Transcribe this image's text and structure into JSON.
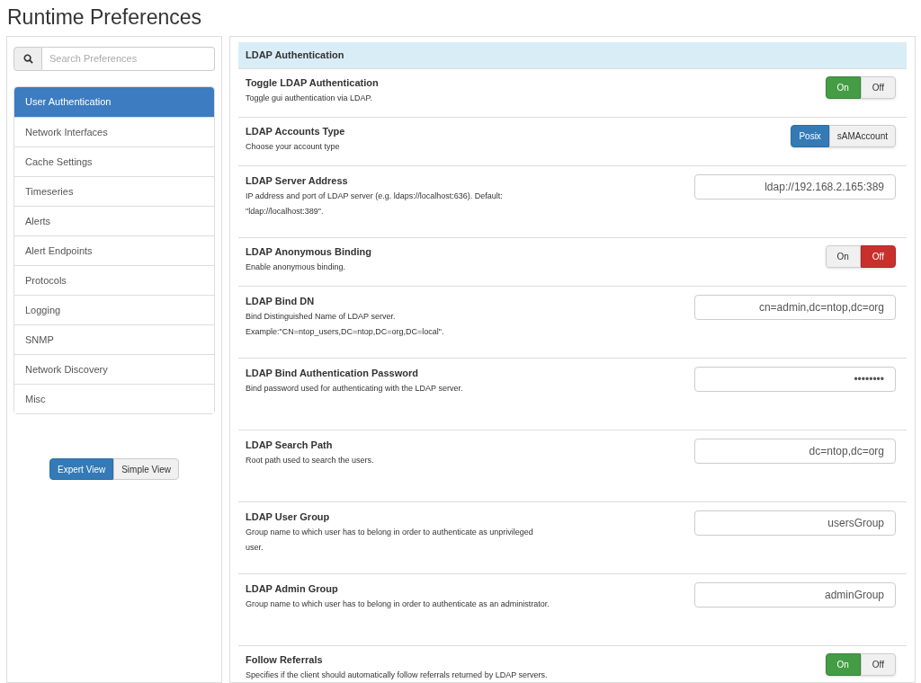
{
  "title": "Runtime Preferences",
  "search": {
    "placeholder": "Search Preferences"
  },
  "menu": [
    {
      "label": "User Authentication",
      "selected": true
    },
    {
      "label": "Network Interfaces",
      "selected": false
    },
    {
      "label": "Cache Settings",
      "selected": false
    },
    {
      "label": "Timeseries",
      "selected": false
    },
    {
      "label": "Alerts",
      "selected": false
    },
    {
      "label": "Alert Endpoints",
      "selected": false
    },
    {
      "label": "Protocols",
      "selected": false
    },
    {
      "label": "Logging",
      "selected": false
    },
    {
      "label": "SNMP",
      "selected": false
    },
    {
      "label": "Network Discovery",
      "selected": false
    },
    {
      "label": "Misc",
      "selected": false
    }
  ],
  "views": [
    {
      "label": "Expert View",
      "selected": true
    },
    {
      "label": "Simple View",
      "selected": false
    }
  ],
  "section": {
    "title": "LDAP Authentication"
  },
  "settings": [
    {
      "kind": "toggle",
      "title": "Toggle LDAP Authentication",
      "description": "Toggle gui authentication via LDAP.",
      "on": true,
      "labels": [
        "On",
        "Off"
      ]
    },
    {
      "kind": "choice",
      "title": "LDAP Accounts Type",
      "description": "Choose your account type",
      "options": [
        {
          "label": "Posix",
          "selected": true
        },
        {
          "label": "sAMAccount",
          "selected": false
        }
      ]
    },
    {
      "kind": "text",
      "title": "LDAP Server Address",
      "description": "IP address and port of LDAP server (e.g. ldaps://localhost:636). Default: \"ldap://localhost:389\".",
      "value": "ldap://192.168.2.165:389"
    },
    {
      "kind": "toggle",
      "title": "LDAP Anonymous Binding",
      "description": "Enable anonymous binding.",
      "on": false,
      "labels": [
        "On",
        "Off"
      ]
    },
    {
      "kind": "text",
      "title": "LDAP Bind DN",
      "description": "Bind Distinguished Name of LDAP server. Example:\"CN=ntop_users,DC=ntop,DC=org,DC=local\".",
      "value": "cn=admin,dc=ntop,dc=org"
    },
    {
      "kind": "text",
      "title": "LDAP Bind Authentication Password",
      "description": "Bind password used for authenticating with the LDAP server.",
      "value": "••••••••"
    },
    {
      "kind": "text",
      "title": "LDAP Search Path",
      "description": "Root path used to search the users.",
      "value": "dc=ntop,dc=org"
    },
    {
      "kind": "text",
      "title": "LDAP User Group",
      "description": "Group name to which user has to belong in order to authenticate as unprivileged user.",
      "value": "usersGroup"
    },
    {
      "kind": "text",
      "title": "LDAP Admin Group",
      "description": "Group name to which user has to belong in order to authenticate as an administrator.",
      "value": "adminGroup"
    },
    {
      "kind": "toggle",
      "title": "Follow Referrals",
      "description": "Specifies if the client should automatically follow referrals returned by LDAP servers.",
      "on": true,
      "labels": [
        "On",
        "Off"
      ]
    }
  ]
}
